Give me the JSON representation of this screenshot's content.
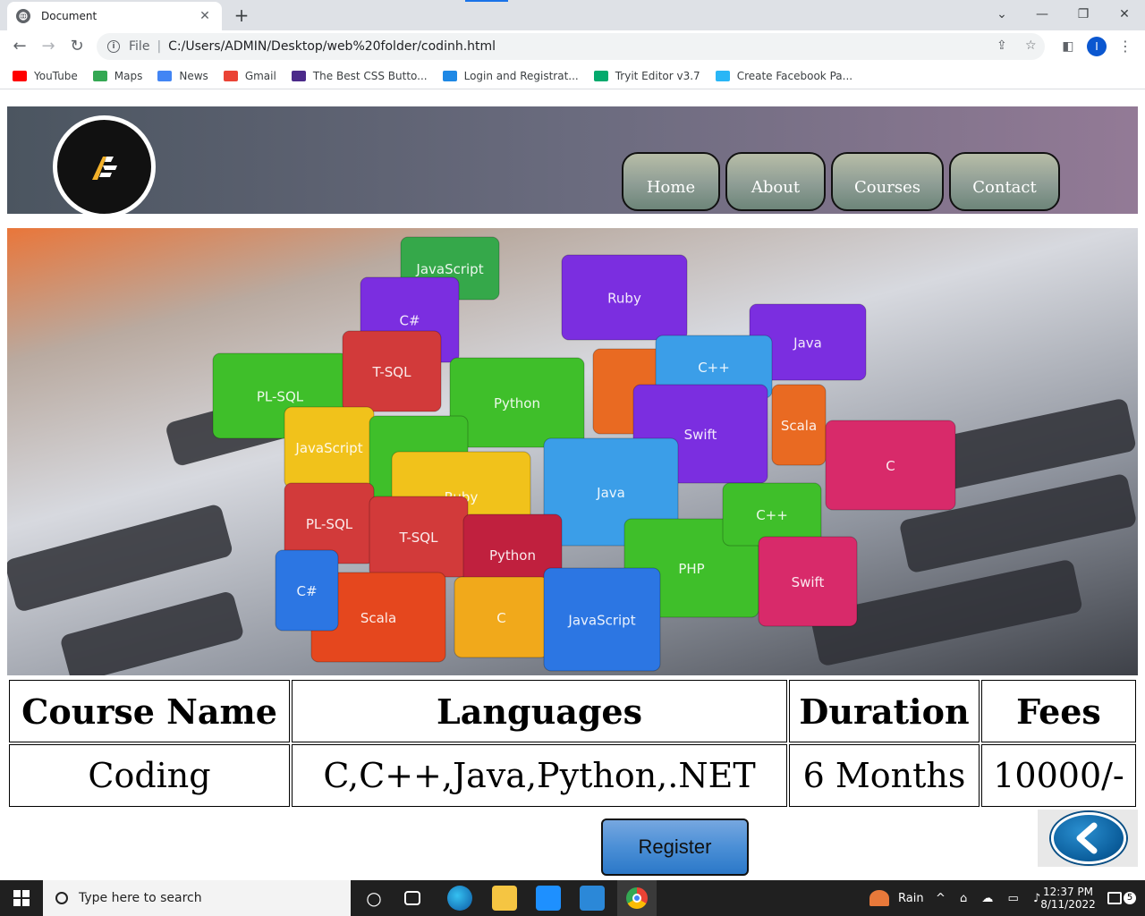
{
  "browser": {
    "tab_title": "Document",
    "tab_close": "✕",
    "new_tab": "+",
    "window_controls": {
      "dropdown": "⌄",
      "minimize": "—",
      "restore": "❐",
      "close": "✕"
    },
    "back": "←",
    "forward": "→",
    "reload": "↻",
    "address_scheme": "File",
    "address_url": "C:/Users/ADMIN/Desktop/web%20folder/codinh.html",
    "profile_initial": "I",
    "bookmarks": [
      {
        "label": "YouTube",
        "color": "#ff0000"
      },
      {
        "label": "Maps",
        "color": "#34a853"
      },
      {
        "label": "News",
        "color": "#4285f4"
      },
      {
        "label": "Gmail",
        "color": "#ea4335"
      },
      {
        "label": "The Best CSS Butto...",
        "color": "#4b2a8a"
      },
      {
        "label": "Login and Registrat...",
        "color": "#1e88e5"
      },
      {
        "label": "Tryit Editor v3.7",
        "color": "#04aa6d"
      },
      {
        "label": "Create Facebook Pa...",
        "color": "#29b6f6"
      }
    ]
  },
  "site": {
    "logo_icon": "af-logo-icon",
    "nav": [
      "Home",
      "About",
      "Courses",
      "Contact"
    ],
    "hero_image": "programming-language-cubes-on-laptop-keyboard",
    "hero_cube_labels": [
      "JavaScript",
      "C#",
      "Ruby",
      "Java",
      "PL-SQL",
      "T-SQL",
      "Python",
      "PHP",
      "C++",
      "Swift",
      "Scala",
      "C"
    ],
    "table": {
      "headers": [
        "Course Name",
        "Languages",
        "Duration",
        "Fees"
      ],
      "rows": [
        [
          "Coding",
          "C,C++,Java,Python,.NET",
          "6 Months",
          "10000/-"
        ]
      ]
    },
    "register_label": "Register",
    "back_icon": "chevron-left-icon"
  },
  "taskbar": {
    "search_placeholder": "Type here to search",
    "weather": "Rain",
    "time": "12:37 PM",
    "date": "8/11/2022",
    "notifications": "5"
  }
}
